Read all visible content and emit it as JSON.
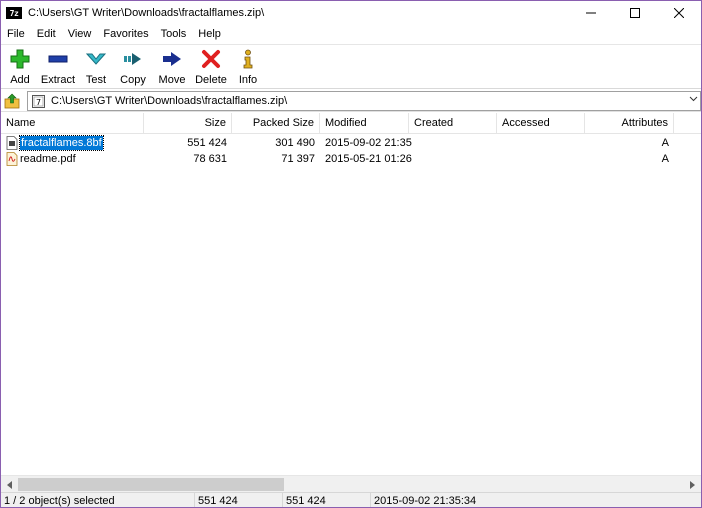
{
  "window": {
    "title": "C:\\Users\\GT Writer\\Downloads\\fractalflames.zip\\",
    "app_icon_text": "7z",
    "minimize": "—",
    "maximize": "☐",
    "close": "✕"
  },
  "menu": [
    "File",
    "Edit",
    "View",
    "Favorites",
    "Tools",
    "Help"
  ],
  "toolbar": [
    {
      "label": "Add",
      "icon": "plus-icon",
      "color": "#2db82d"
    },
    {
      "label": "Extract",
      "icon": "minus-icon",
      "color": "#1f3fa8"
    },
    {
      "label": "Test",
      "icon": "check-icon",
      "color": "#2fa7b8"
    },
    {
      "label": "Copy",
      "icon": "copy-arrow-icon",
      "color": "#2a8fa0"
    },
    {
      "label": "Move",
      "icon": "move-arrow-icon",
      "color": "#1a2f8f"
    },
    {
      "label": "Delete",
      "icon": "delete-x-icon",
      "color": "#e02020"
    },
    {
      "label": "Info",
      "icon": "info-icon",
      "color": "#c8a020"
    }
  ],
  "address": {
    "path": "C:\\Users\\GT Writer\\Downloads\\fractalflames.zip\\"
  },
  "columns": {
    "name": "Name",
    "size": "Size",
    "packed": "Packed Size",
    "modified": "Modified",
    "created": "Created",
    "accessed": "Accessed",
    "attributes": "Attributes"
  },
  "files": [
    {
      "name": "fractalflames.8bf",
      "size": "551 424",
      "packed": "301 490",
      "modified": "2015-09-02 21:35",
      "created": "",
      "accessed": "",
      "attributes": "A",
      "selected": true,
      "icon": "file-icon"
    },
    {
      "name": "readme.pdf",
      "size": "78 631",
      "packed": "71 397",
      "modified": "2015-05-21 01:26",
      "created": "",
      "accessed": "",
      "attributes": "A",
      "selected": false,
      "icon": "pdf-file-icon"
    }
  ],
  "status": {
    "selection": "1 / 2 object(s) selected",
    "size": "551 424",
    "packed": "551 424",
    "modified": "2015-09-02 21:35:34"
  },
  "colors": {
    "selection": "#0078d7",
    "window_border": "#8a5fb0"
  }
}
